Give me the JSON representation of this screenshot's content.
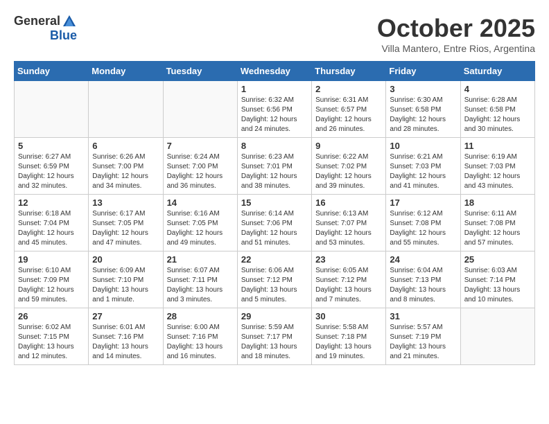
{
  "header": {
    "logo_general": "General",
    "logo_blue": "Blue",
    "month": "October 2025",
    "location": "Villa Mantero, Entre Rios, Argentina"
  },
  "days_of_week": [
    "Sunday",
    "Monday",
    "Tuesday",
    "Wednesday",
    "Thursday",
    "Friday",
    "Saturday"
  ],
  "weeks": [
    {
      "days": [
        {
          "number": "",
          "empty": true
        },
        {
          "number": "",
          "empty": true
        },
        {
          "number": "",
          "empty": true
        },
        {
          "number": "1",
          "sunrise": "6:32 AM",
          "sunset": "6:56 PM",
          "daylight": "12 hours and 24 minutes."
        },
        {
          "number": "2",
          "sunrise": "6:31 AM",
          "sunset": "6:57 PM",
          "daylight": "12 hours and 26 minutes."
        },
        {
          "number": "3",
          "sunrise": "6:30 AM",
          "sunset": "6:58 PM",
          "daylight": "12 hours and 28 minutes."
        },
        {
          "number": "4",
          "sunrise": "6:28 AM",
          "sunset": "6:58 PM",
          "daylight": "12 hours and 30 minutes."
        }
      ]
    },
    {
      "days": [
        {
          "number": "5",
          "sunrise": "6:27 AM",
          "sunset": "6:59 PM",
          "daylight": "12 hours and 32 minutes."
        },
        {
          "number": "6",
          "sunrise": "6:26 AM",
          "sunset": "7:00 PM",
          "daylight": "12 hours and 34 minutes."
        },
        {
          "number": "7",
          "sunrise": "6:24 AM",
          "sunset": "7:00 PM",
          "daylight": "12 hours and 36 minutes."
        },
        {
          "number": "8",
          "sunrise": "6:23 AM",
          "sunset": "7:01 PM",
          "daylight": "12 hours and 38 minutes."
        },
        {
          "number": "9",
          "sunrise": "6:22 AM",
          "sunset": "7:02 PM",
          "daylight": "12 hours and 39 minutes."
        },
        {
          "number": "10",
          "sunrise": "6:21 AM",
          "sunset": "7:03 PM",
          "daylight": "12 hours and 41 minutes."
        },
        {
          "number": "11",
          "sunrise": "6:19 AM",
          "sunset": "7:03 PM",
          "daylight": "12 hours and 43 minutes."
        }
      ]
    },
    {
      "days": [
        {
          "number": "12",
          "sunrise": "6:18 AM",
          "sunset": "7:04 PM",
          "daylight": "12 hours and 45 minutes."
        },
        {
          "number": "13",
          "sunrise": "6:17 AM",
          "sunset": "7:05 PM",
          "daylight": "12 hours and 47 minutes."
        },
        {
          "number": "14",
          "sunrise": "6:16 AM",
          "sunset": "7:05 PM",
          "daylight": "12 hours and 49 minutes."
        },
        {
          "number": "15",
          "sunrise": "6:14 AM",
          "sunset": "7:06 PM",
          "daylight": "12 hours and 51 minutes."
        },
        {
          "number": "16",
          "sunrise": "6:13 AM",
          "sunset": "7:07 PM",
          "daylight": "12 hours and 53 minutes."
        },
        {
          "number": "17",
          "sunrise": "6:12 AM",
          "sunset": "7:08 PM",
          "daylight": "12 hours and 55 minutes."
        },
        {
          "number": "18",
          "sunrise": "6:11 AM",
          "sunset": "7:08 PM",
          "daylight": "12 hours and 57 minutes."
        }
      ]
    },
    {
      "days": [
        {
          "number": "19",
          "sunrise": "6:10 AM",
          "sunset": "7:09 PM",
          "daylight": "12 hours and 59 minutes."
        },
        {
          "number": "20",
          "sunrise": "6:09 AM",
          "sunset": "7:10 PM",
          "daylight": "13 hours and 1 minute."
        },
        {
          "number": "21",
          "sunrise": "6:07 AM",
          "sunset": "7:11 PM",
          "daylight": "13 hours and 3 minutes."
        },
        {
          "number": "22",
          "sunrise": "6:06 AM",
          "sunset": "7:12 PM",
          "daylight": "13 hours and 5 minutes."
        },
        {
          "number": "23",
          "sunrise": "6:05 AM",
          "sunset": "7:12 PM",
          "daylight": "13 hours and 7 minutes."
        },
        {
          "number": "24",
          "sunrise": "6:04 AM",
          "sunset": "7:13 PM",
          "daylight": "13 hours and 8 minutes."
        },
        {
          "number": "25",
          "sunrise": "6:03 AM",
          "sunset": "7:14 PM",
          "daylight": "13 hours and 10 minutes."
        }
      ]
    },
    {
      "days": [
        {
          "number": "26",
          "sunrise": "6:02 AM",
          "sunset": "7:15 PM",
          "daylight": "13 hours and 12 minutes."
        },
        {
          "number": "27",
          "sunrise": "6:01 AM",
          "sunset": "7:16 PM",
          "daylight": "13 hours and 14 minutes."
        },
        {
          "number": "28",
          "sunrise": "6:00 AM",
          "sunset": "7:16 PM",
          "daylight": "13 hours and 16 minutes."
        },
        {
          "number": "29",
          "sunrise": "5:59 AM",
          "sunset": "7:17 PM",
          "daylight": "13 hours and 18 minutes."
        },
        {
          "number": "30",
          "sunrise": "5:58 AM",
          "sunset": "7:18 PM",
          "daylight": "13 hours and 19 minutes."
        },
        {
          "number": "31",
          "sunrise": "5:57 AM",
          "sunset": "7:19 PM",
          "daylight": "13 hours and 21 minutes."
        },
        {
          "number": "",
          "empty": true
        }
      ]
    }
  ]
}
